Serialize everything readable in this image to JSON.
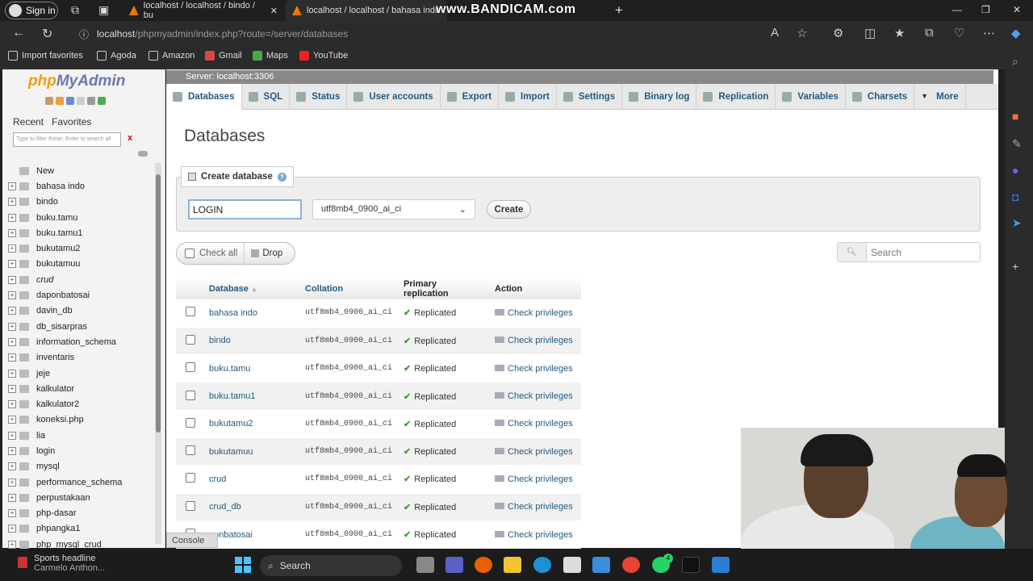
{
  "browser": {
    "signin": "Sign in",
    "tabs": [
      {
        "title": "localhost / localhost / bindo / bu"
      },
      {
        "title": "localhost / localhost / bahasa indo"
      }
    ],
    "watermark": "www.BANDICAM.com",
    "url_host": "localhost",
    "url_path": "/phpmyadmin/index.php?route=/server/databases",
    "favorites": [
      "Import favorites",
      "Agoda",
      "Amazon",
      "Gmail",
      "Maps",
      "YouTube"
    ]
  },
  "pma": {
    "logo_php": "php",
    "logo_myadmin": "MyAdmin",
    "nav_tabs": [
      "Recent",
      "Favorites"
    ],
    "filter_placeholder": "Type to filter these, Enter to search all",
    "filter_clear": "x",
    "tree": [
      "New",
      "bahasa indo",
      "bindo",
      "buku.tamu",
      "buku.tamu1",
      "bukutamu2",
      "bukutamuu",
      "crud",
      "daponbatosai",
      "davin_db",
      "db_sisarpras",
      "information_schema",
      "inventaris",
      "jeje",
      "kalkulator",
      "kalkulator2",
      "koneksi.php",
      "lia",
      "login",
      "mysql",
      "performance_schema",
      "perpustakaan",
      "php-dasar",
      "phpangka1",
      "php_mysql_crud"
    ],
    "server_bar": "Server: localhost:3306",
    "menu": [
      "Databases",
      "SQL",
      "Status",
      "User accounts",
      "Export",
      "Import",
      "Settings",
      "Binary log",
      "Replication",
      "Variables",
      "Charsets",
      "More"
    ],
    "heading": "Databases",
    "create_db_legend": "Create database",
    "db_name_value": "LOGIN",
    "collation_value": "utf8mb4_0900_ai_ci",
    "create_button": "Create",
    "check_all": "Check all",
    "drop": "Drop",
    "search_placeholder": "Search",
    "columns": [
      "Database",
      "Collation",
      "Primary replication",
      "Action"
    ],
    "rows": [
      {
        "db": "bahasa indo",
        "collation": "utf8mb4_0900_ai_ci",
        "replication": "Replicated",
        "action": "Check privileges"
      },
      {
        "db": "bindo",
        "collation": "utf8mb4_0900_ai_ci",
        "replication": "Replicated",
        "action": "Check privileges"
      },
      {
        "db": "buku.tamu",
        "collation": "utf8mb4_0900_ai_ci",
        "replication": "Replicated",
        "action": "Check privileges"
      },
      {
        "db": "buku.tamu1",
        "collation": "utf8mb4_0900_ai_ci",
        "replication": "Replicated",
        "action": "Check privileges"
      },
      {
        "db": "bukutamu2",
        "collation": "utf8mb4_0900_ai_ci",
        "replication": "Replicated",
        "action": "Check privileges"
      },
      {
        "db": "bukutamuu",
        "collation": "utf8mb4_0900_ai_ci",
        "replication": "Replicated",
        "action": "Check privileges"
      },
      {
        "db": "crud",
        "collation": "utf8mb4_0900_ai_ci",
        "replication": "Replicated",
        "action": "Check privileges"
      },
      {
        "db": "crud_db",
        "collation": "utf8mb4_0900_ai_ci",
        "replication": "Replicated",
        "action": "Check privileges"
      },
      {
        "db": "ponbatosai",
        "collation": "utf8mb4_0900_ai_ci",
        "replication": "Replicated",
        "action": "Check privileges"
      }
    ],
    "console": "Console"
  },
  "taskbar": {
    "news_title": "Sports headline",
    "news_sub": "Carmelo Anthon...",
    "search": "Search",
    "whatsapp_badge": "4"
  }
}
